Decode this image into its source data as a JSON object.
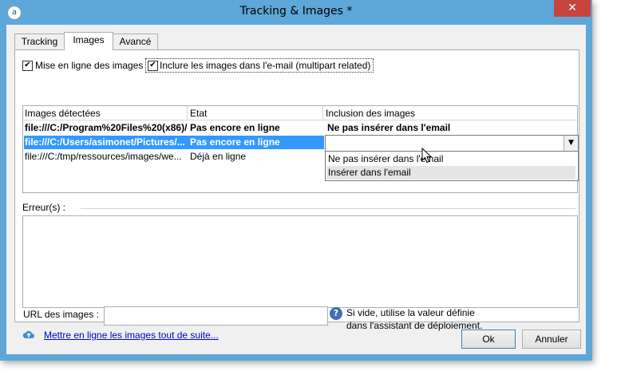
{
  "window": {
    "title": "Tracking & Images *",
    "close_glyph": "✕",
    "app_icon_glyph": "a"
  },
  "tabs": [
    {
      "label": "Tracking"
    },
    {
      "label": "Images",
      "active": true
    },
    {
      "label": "Avancé"
    }
  ],
  "options": {
    "publish_images": {
      "label": "Mise en ligne des images",
      "checked": true
    },
    "include_images": {
      "label": "Inclure les images dans l'e-mail (multipart related)",
      "checked": true
    }
  },
  "grid": {
    "columns": [
      "Images détectées",
      "Etat",
      "Inclusion des images"
    ],
    "rows": [
      {
        "image": "file:///C:/Program%20Files%20(x86)/...",
        "state": "Pas encore en ligne",
        "inclusion": "Ne pas insérer dans l'email",
        "bold": true
      },
      {
        "image": "file:///C:/Users/asimonet/Pictures/...",
        "state": "Pas encore en ligne",
        "inclusion": "",
        "bold": true,
        "selected": true
      },
      {
        "image": "file:///C:/tmp/ressources/images/we...",
        "state": "Déjà en ligne",
        "inclusion": ""
      }
    ],
    "dropdown_options": [
      "Ne pas insérer dans l'email",
      "Insérer dans l'email"
    ],
    "hovered_option": "Insérer dans l'email"
  },
  "errors": {
    "label": "Erreur(s) :"
  },
  "url": {
    "label": "URL des images :",
    "value": "",
    "help_line1": "Si vide, utilise la valeur définie",
    "help_line2": "dans l'assistant de déploiement."
  },
  "upload_link": "Mettre en ligne les images tout de suite...",
  "buttons": {
    "ok": "Ok",
    "cancel": "Annuler"
  },
  "colors": {
    "titlebar": "#5ea7d9",
    "selection": "#3399ff",
    "close": "#c7443f",
    "link": "#0000cc"
  }
}
